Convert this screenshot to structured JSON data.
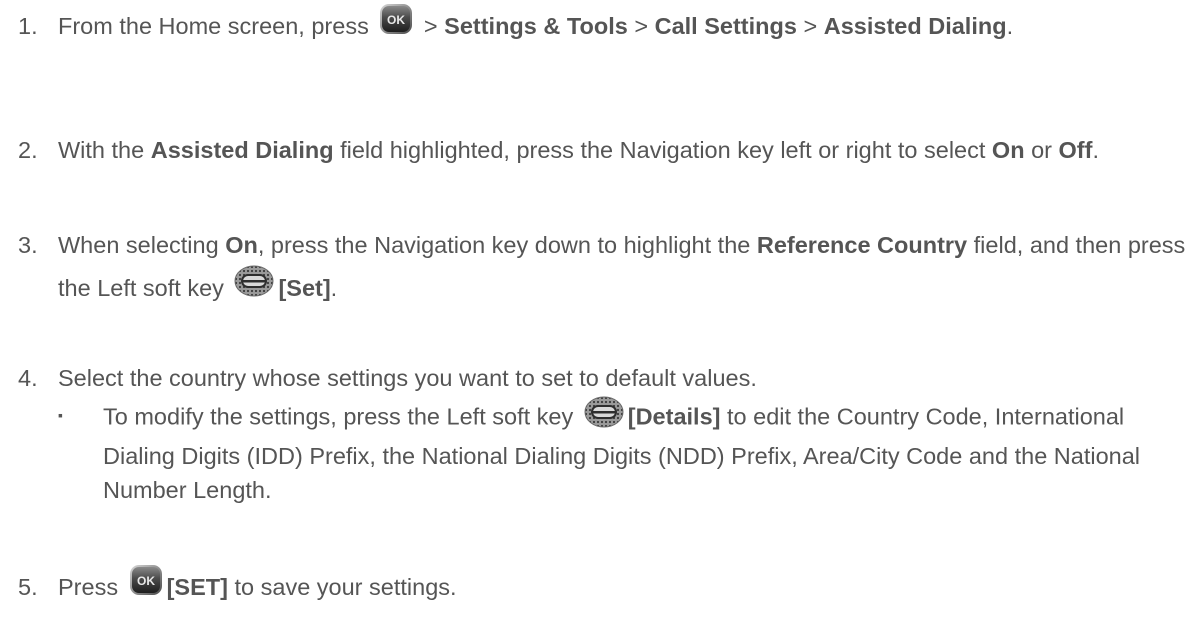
{
  "steps": [
    {
      "num": "1.",
      "t1": "From the Home screen, press ",
      "sep1": " > ",
      "b1": "Settings & Tools",
      "sep2": " > ",
      "b2": "Call Settings",
      "sep3": " > ",
      "b3": "Assisted Dialing",
      "end": "."
    },
    {
      "num": "2.",
      "t1": "With the ",
      "b1": "Assisted Dialing",
      "t2": " field highlighted, press the Navigation key left or right to select ",
      "b2": "On",
      "t3": " or ",
      "b3": "Off",
      "end": "."
    },
    {
      "num": "3.",
      "t1": "When selecting ",
      "b1": "On",
      "t2": ", press the Navigation key down to highlight the ",
      "b2": "Reference Country",
      "t3": " field, and then press the Left soft key ",
      "b3": "[Set]",
      "end": "."
    },
    {
      "num": "4.",
      "t1": "Select the country whose settings you want to set to default values."
    },
    {
      "num": "5.",
      "t1": "Press ",
      "b1": "[SET]",
      "t2": " to save your settings."
    }
  ],
  "bullet": {
    "mark": "▪",
    "t1": "To modify the settings, press the Left soft key ",
    "b1": "[Details]",
    "t2": " to edit the Country Code, International Dialing Digits (IDD) Prefix, the National Dialing Digits (NDD) Prefix, Area/City Code and the National Number Length."
  },
  "keys": {
    "ok_label": "OK"
  }
}
